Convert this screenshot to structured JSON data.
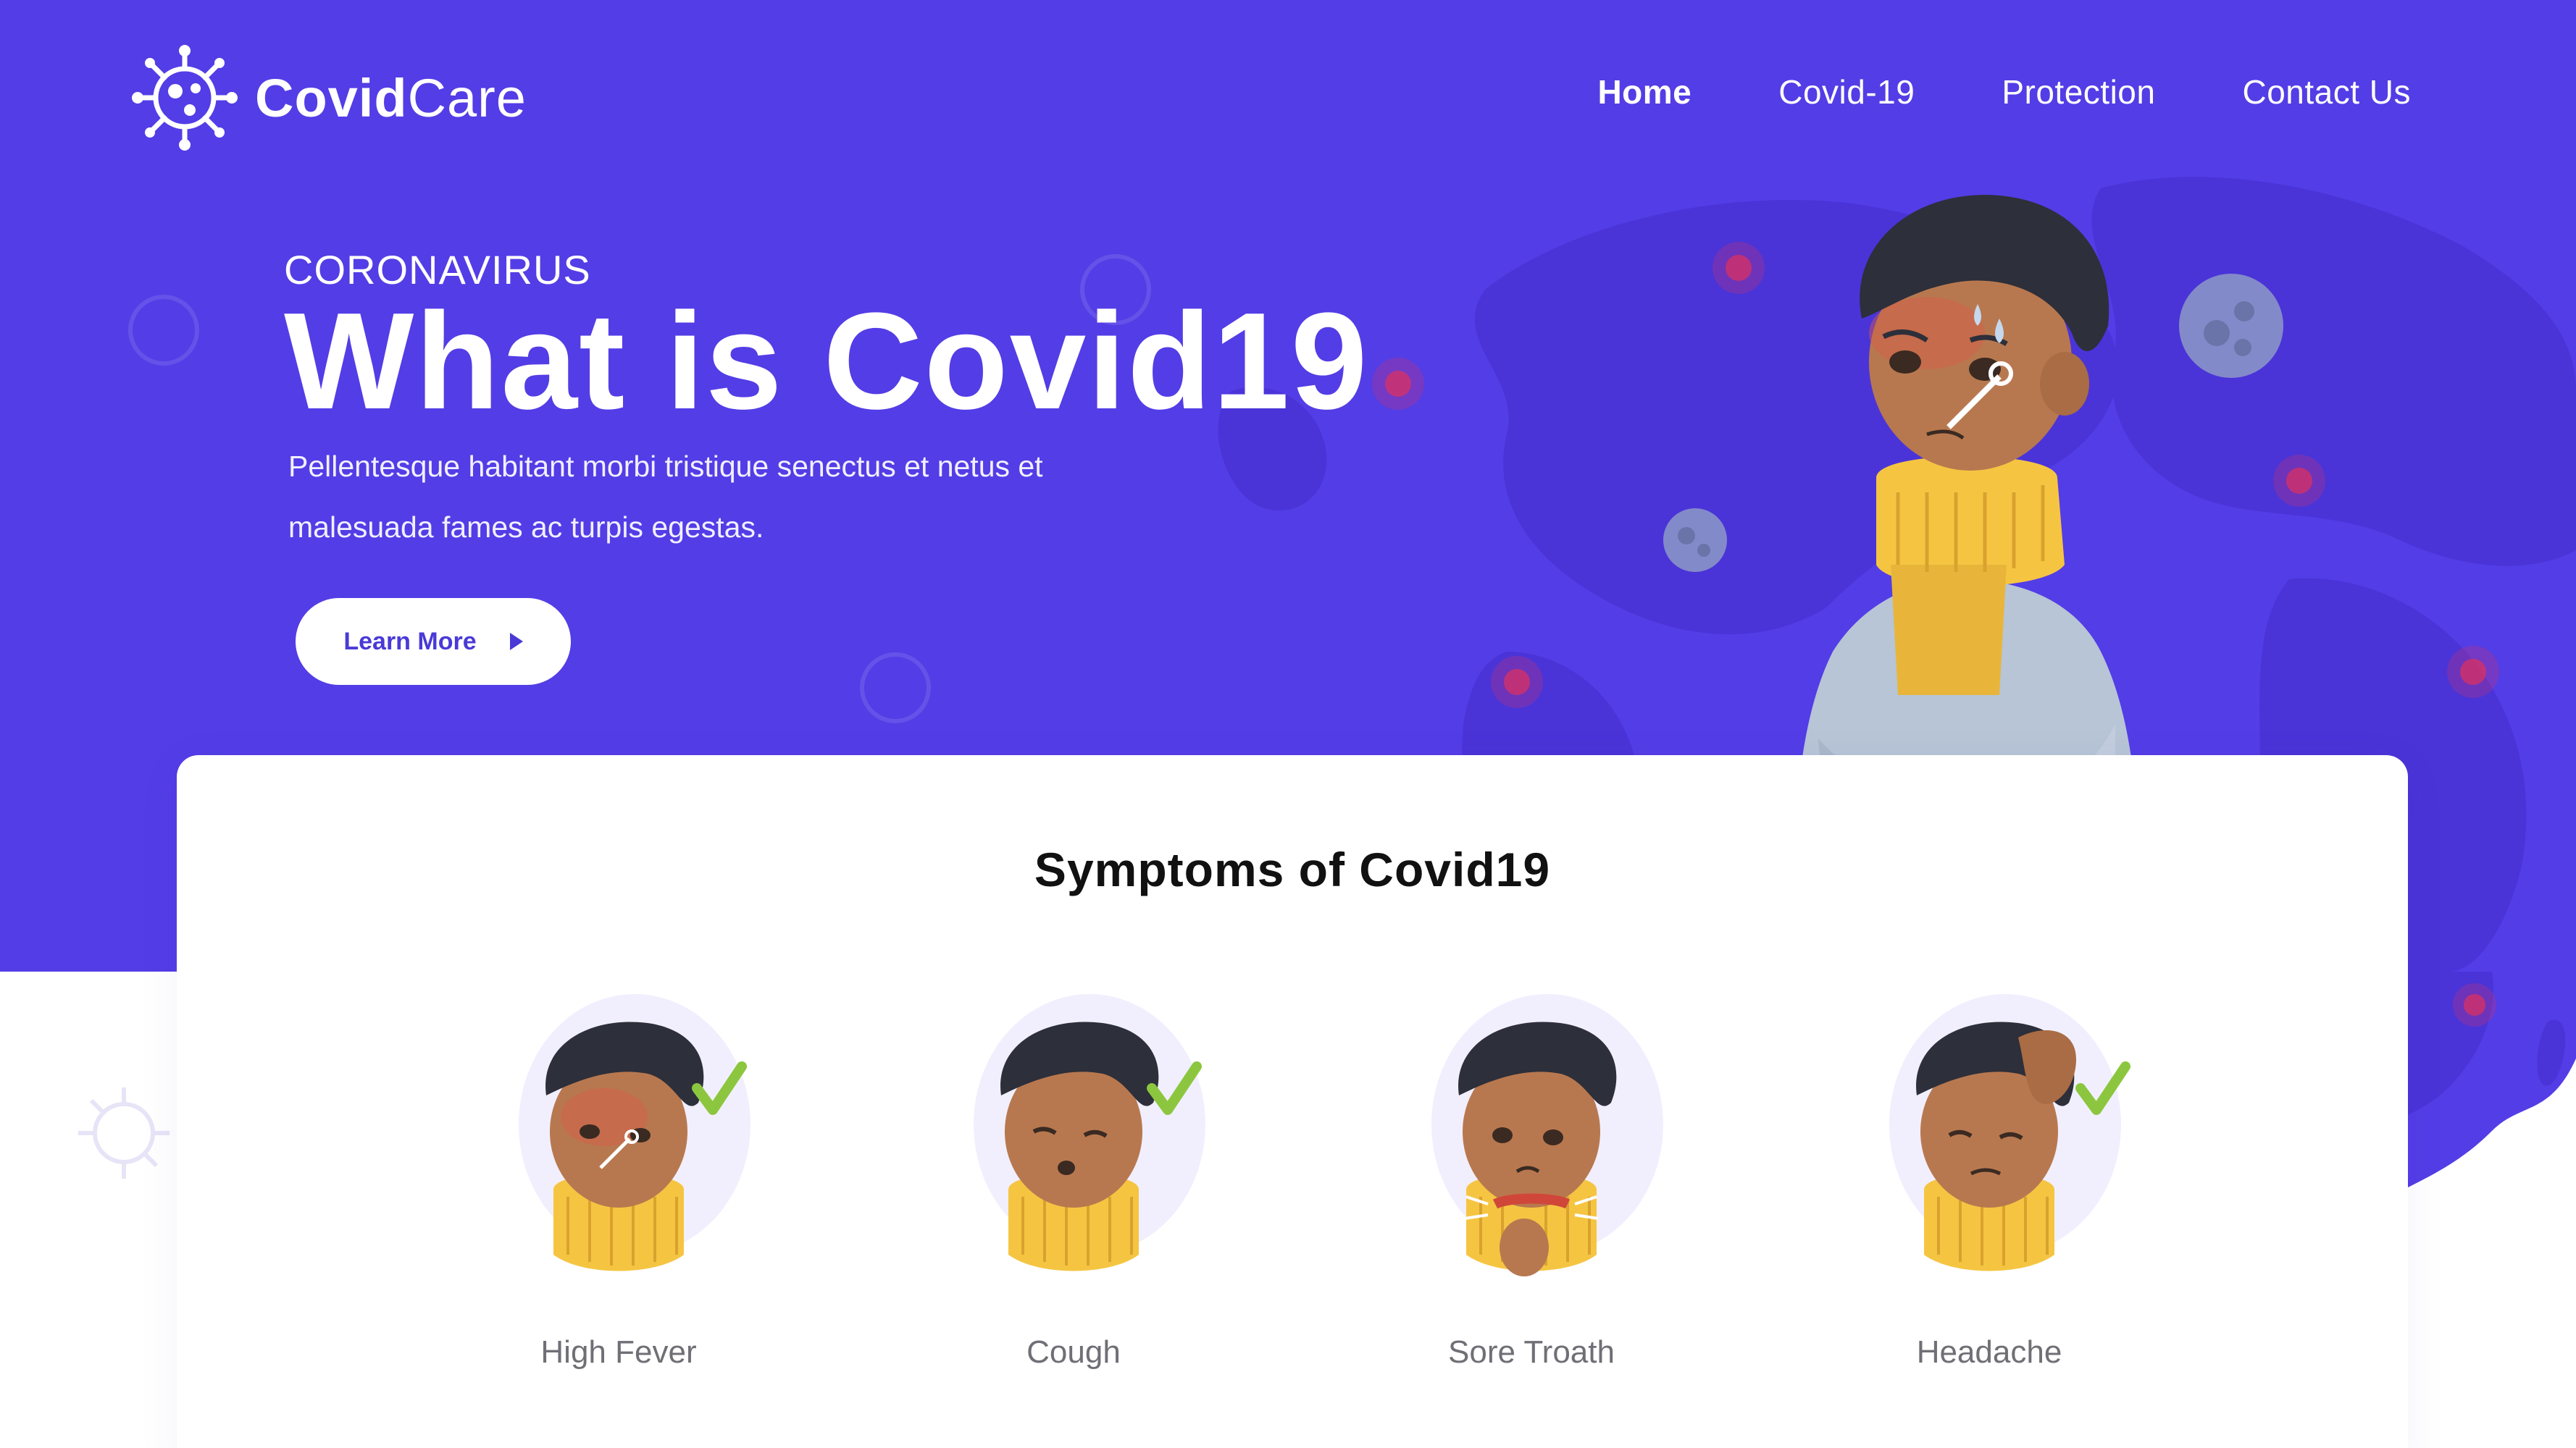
{
  "brand": {
    "name_bold": "Covid",
    "name_light": "Care"
  },
  "nav": {
    "items": [
      {
        "label": "Home",
        "active": true
      },
      {
        "label": "Covid-19",
        "active": false
      },
      {
        "label": "Protection",
        "active": false
      },
      {
        "label": "Contact Us",
        "active": false
      }
    ]
  },
  "hero": {
    "eyebrow": "CORONAVIRUS",
    "title": "What is Covid19",
    "description_line1": "Pellentesque habitant morbi tristique senectus et netus et",
    "description_line2": "malesuada fames ac turpis egestas.",
    "cta_label": "Learn More"
  },
  "symptoms": {
    "title": "Symptoms of Covid19",
    "items": [
      {
        "label": "High Fever",
        "icon": "high-fever-illustration"
      },
      {
        "label": "Cough",
        "icon": "cough-illustration"
      },
      {
        "label": "Sore Troath",
        "icon": "sore-throat-illustration"
      },
      {
        "label": "Headache",
        "icon": "headache-illustration"
      }
    ]
  },
  "colors": {
    "hero_bg": "#533de6",
    "accent": "#4a3ad6",
    "check": "#8cc63f",
    "scarf": "#f5c542",
    "skin": "#b8784f",
    "hair": "#2d2f3a"
  }
}
